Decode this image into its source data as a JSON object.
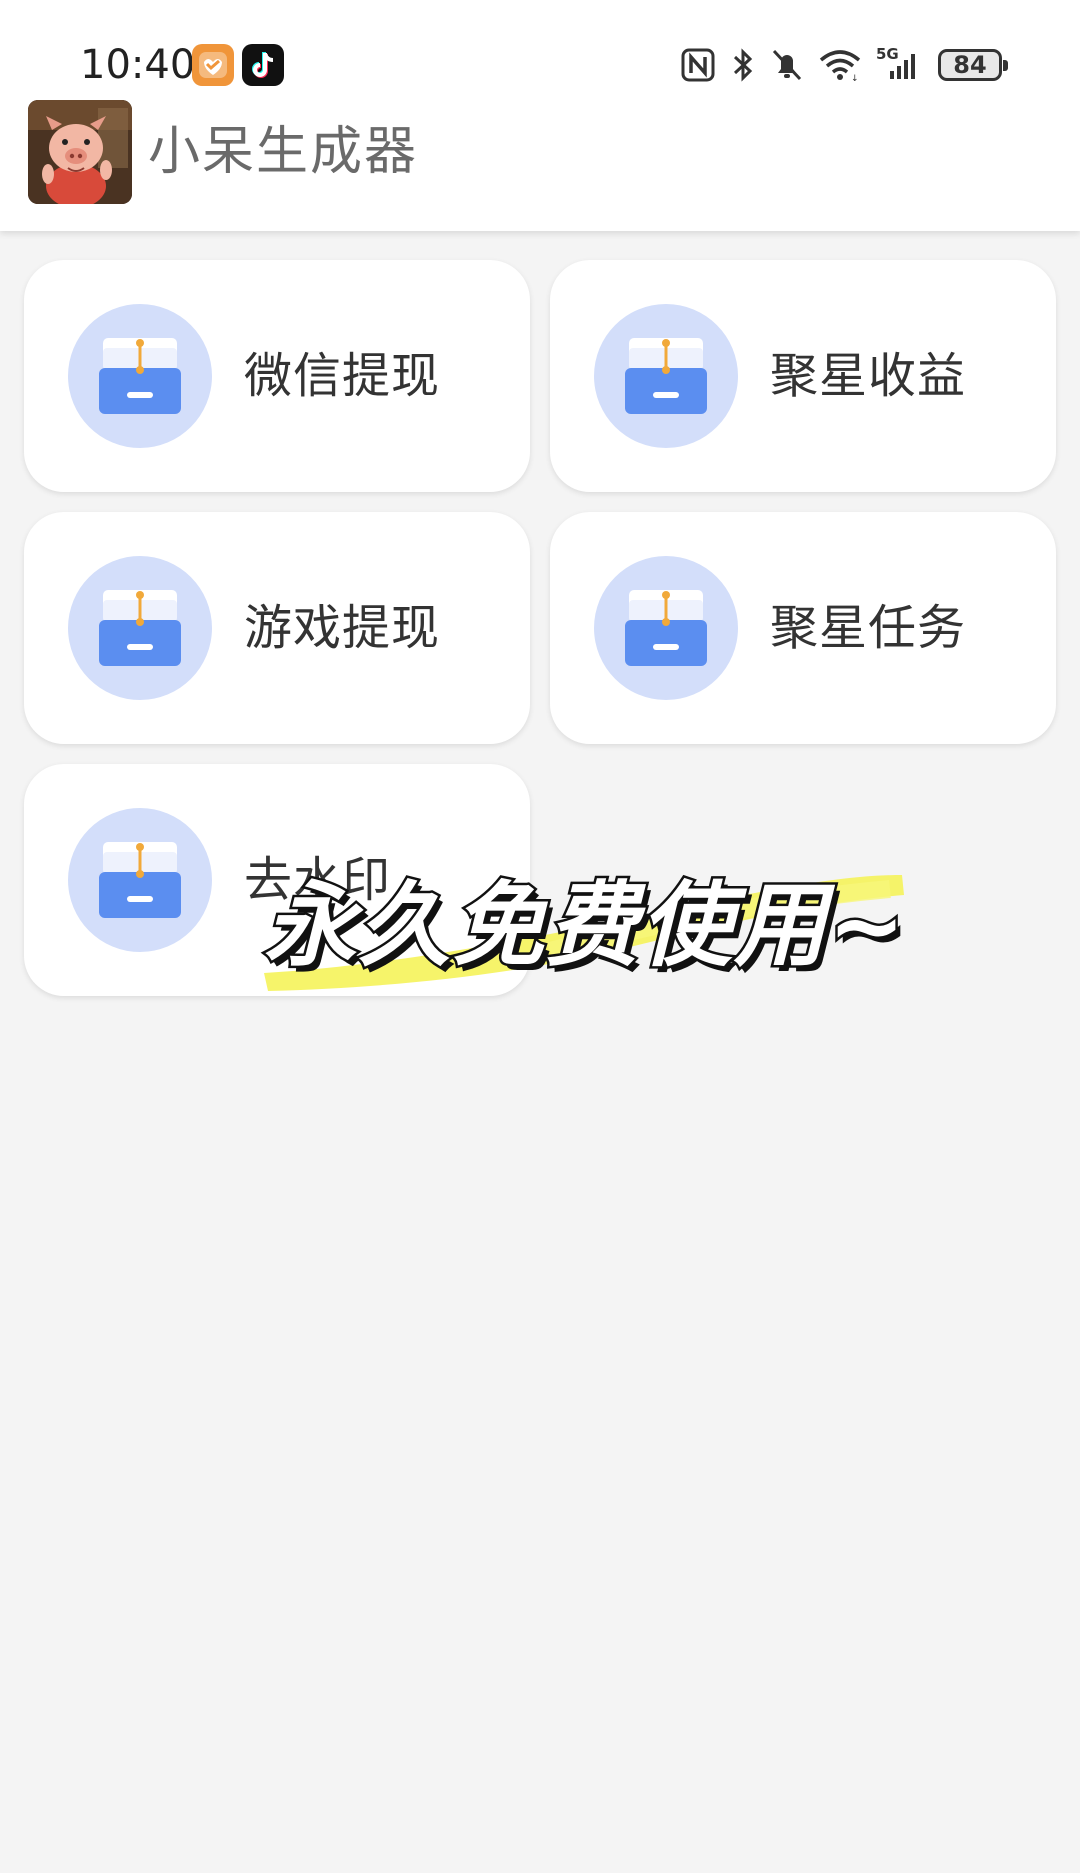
{
  "status_bar": {
    "time": "10:40",
    "network": "5G",
    "battery": "84",
    "icons": [
      "health-app-icon",
      "tiktok-icon",
      "nfc-icon",
      "bluetooth-icon",
      "mute-icon",
      "wifi-icon",
      "signal-icon",
      "battery-icon"
    ]
  },
  "app_bar": {
    "title": "小呆生成器",
    "avatar": "pig-avatar"
  },
  "menu": {
    "items": [
      {
        "label": "微信提现",
        "icon": "inbox-icon"
      },
      {
        "label": "聚星收益",
        "icon": "inbox-icon"
      },
      {
        "label": "游戏提现",
        "icon": "inbox-icon"
      },
      {
        "label": "聚星任务",
        "icon": "inbox-icon"
      },
      {
        "label": "去水印",
        "icon": "inbox-icon"
      }
    ]
  },
  "overlay": {
    "caption": "永久免费使用~",
    "highlight_color": "#f5f35a"
  },
  "colors": {
    "icon_circle": "#d3defa",
    "icon_blue": "#5b8ef0",
    "icon_dot": "#f1a93a",
    "background": "#f4f4f4"
  }
}
